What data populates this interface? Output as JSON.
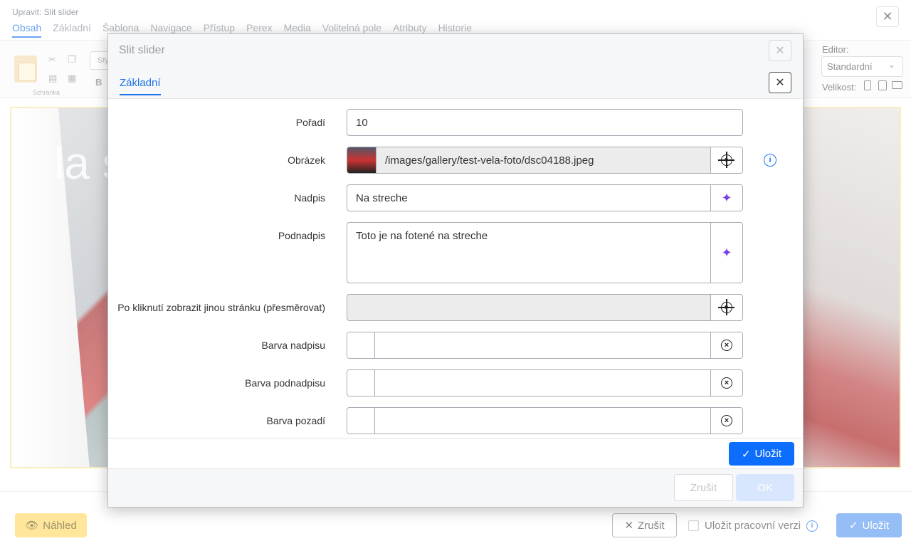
{
  "editor": {
    "title": "Upravit: Slit slider",
    "tabs": [
      "Obsah",
      "Základní",
      "Šablona",
      "Navigace",
      "Přístup",
      "Perex",
      "Media",
      "Volitelná pole",
      "Atributy",
      "Historie"
    ],
    "clipboard_label": "Schránka",
    "style_placeholder": "Sty",
    "bold_label": "B",
    "editor_label": "Editor:",
    "editor_value": "Standardní",
    "size_label": "Velikost:",
    "slide_text": "la s"
  },
  "bottom": {
    "preview_label": "Náhled",
    "cancel_label": "Zrušit",
    "draft_label": "Uložit pracovní verzi",
    "save_label": "Uložit"
  },
  "modal": {
    "title": "Slit slider",
    "tab": "Základní",
    "fields": {
      "poradi": {
        "label": "Pořadí",
        "value": "10"
      },
      "obrazek": {
        "label": "Obrázek",
        "value": "/images/gallery/test-vela-foto/dsc04188.jpeg"
      },
      "nadpis": {
        "label": "Nadpis",
        "value": "Na streche"
      },
      "podnadpis": {
        "label": "Podnadpis",
        "value": "Toto je na fotené na streche"
      },
      "redirect": {
        "label": "Po kliknutí zobrazit jinou stránku (přesměrovat)",
        "value": ""
      },
      "barva_nadpisu": {
        "label": "Barva nadpisu",
        "value": ""
      },
      "barva_podnadpisu": {
        "label": "Barva podnadpisu",
        "value": ""
      },
      "barva_pozadi": {
        "label": "Barva pozadí",
        "value": ""
      }
    },
    "save_label": "Uložit",
    "cancel_label": "Zrušit",
    "ok_label": "OK"
  },
  "colors": {
    "accent": "#0d6efd",
    "sparkle": "#7b3fe4",
    "preview_button": "#ffd966"
  }
}
